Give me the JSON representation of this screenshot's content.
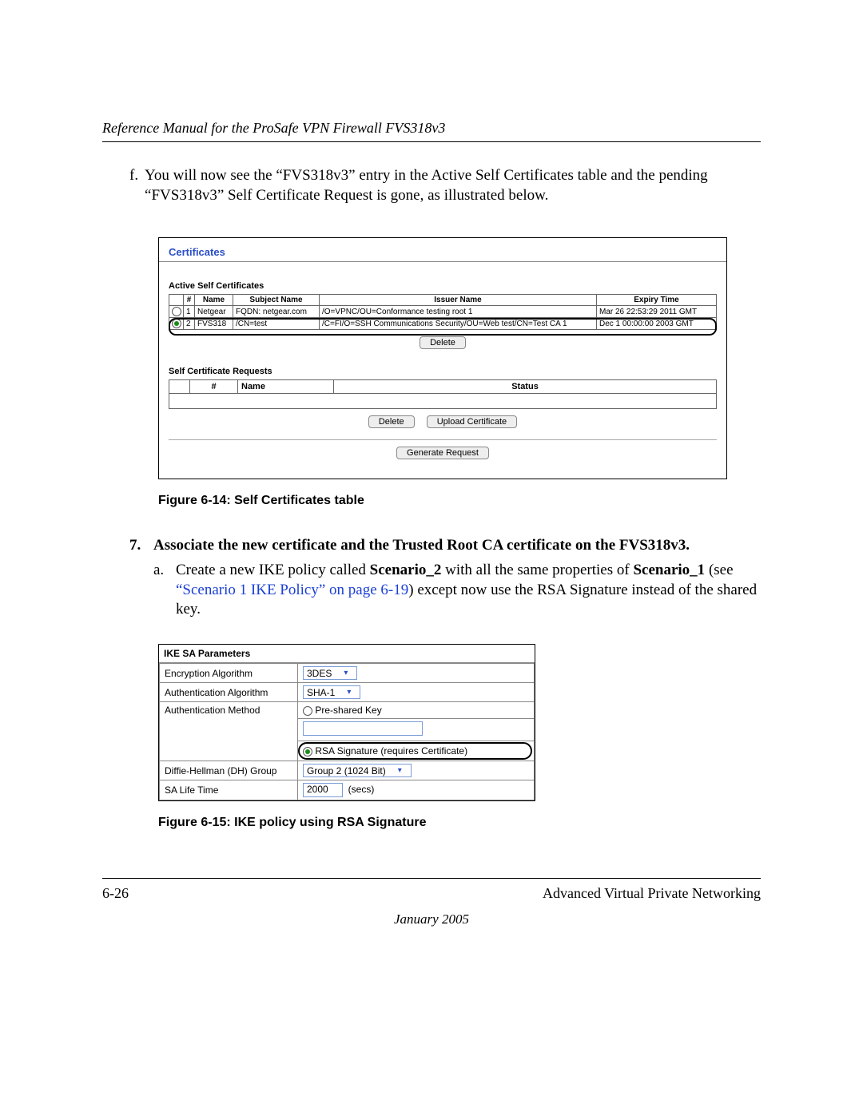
{
  "header": {
    "title": "Reference Manual for the ProSafe VPN Firewall FVS318v3"
  },
  "step_f": {
    "marker": "f.",
    "text": "You will now see the “FVS318v3” entry in the Active Self Certificates table and the pending “FVS318v3” Self Certificate Request is gone, as illustrated below."
  },
  "cert_screenshot": {
    "heading": "Certificates",
    "active_heading": "Active Self Certificates",
    "columns": {
      "num": "#",
      "name": "Name",
      "subject": "Subject Name",
      "issuer": "Issuer Name",
      "expiry": "Expiry Time"
    },
    "rows": [
      {
        "selected": false,
        "num": "1",
        "name": "Netgear",
        "subject": "FQDN: netgear.com",
        "issuer": "/O=VPNC/OU=Conformance testing root 1",
        "expiry": "Mar 26 22:53:29 2011 GMT"
      },
      {
        "selected": true,
        "num": "2",
        "name": "FVS318",
        "subject": "/CN=test",
        "issuer": "/C=FI/O=SSH Communications Security/OU=Web test/CN=Test CA 1",
        "expiry": "Dec 1 00:00:00 2003 GMT"
      }
    ],
    "delete_btn": "Delete",
    "req_heading": "Self Certificate Requests",
    "req_columns": {
      "num": "#",
      "name": "Name",
      "status": "Status"
    },
    "upload_btn": "Upload Certificate",
    "generate_btn": "Generate Request"
  },
  "figure614": "Figure 6-14: Self Certificates table",
  "step7": {
    "marker": "7.",
    "text": "Associate the new certificate and the Trusted Root CA certificate on the FVS318v3."
  },
  "step7a": {
    "marker": "a.",
    "pre": "Create a new IKE policy called ",
    "bold1": "Scenario_2",
    "mid": " with all the same properties of ",
    "bold2": "Scenario_1",
    "see": " (see ",
    "link": "“Scenario 1 IKE Policy” on page 6-19",
    "tail": ") except now use the RSA Signature instead of the shared key."
  },
  "ike": {
    "title": "IKE SA Parameters",
    "enc_label": "Encryption Algorithm",
    "enc_value": "3DES",
    "auth_label": "Authentication Algorithm",
    "auth_value": "SHA-1",
    "method_label": "Authentication Method",
    "psk_label": "Pre-shared Key",
    "rsa_label": "RSA Signature (requires Certificate)",
    "dh_label": "Diffie-Hellman (DH) Group",
    "dh_value": "Group 2 (1024 Bit)",
    "sa_label": "SA Life Time",
    "sa_value": "2000",
    "sa_unit": "(secs)"
  },
  "figure615": "Figure 6-15: IKE policy using RSA Signature",
  "footer": {
    "page_num": "6-26",
    "section": "Advanced Virtual Private Networking",
    "date": "January 2005"
  }
}
